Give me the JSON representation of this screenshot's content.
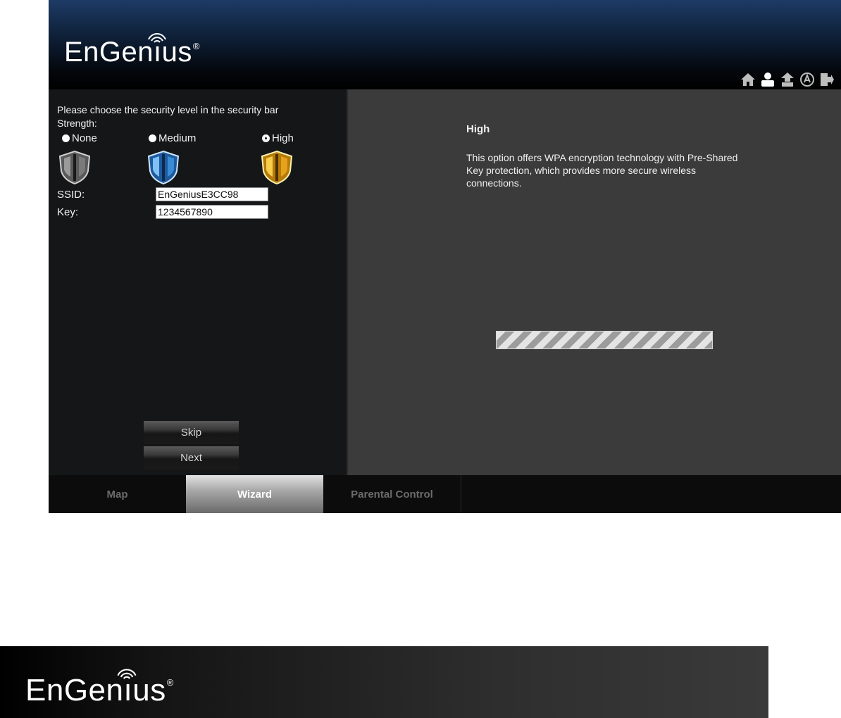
{
  "brand": {
    "name_left": "EnGen",
    "name_i": "ı",
    "name_right": "us",
    "reg_mark": "®"
  },
  "toolbar": {
    "icons": [
      "home-icon",
      "user-icon",
      "upload-icon",
      "wireless-icon",
      "logout-icon"
    ]
  },
  "left_panel": {
    "instruction": "Please choose the security level in the security bar",
    "strength_label": "Strength:",
    "levels": [
      {
        "label": "None",
        "selected": false,
        "color": "#9a9a9a"
      },
      {
        "label": "Medium",
        "selected": false,
        "color": "#3a8bd6"
      },
      {
        "label": "High",
        "selected": true,
        "color": "#e6a21a"
      }
    ],
    "ssid_label": "SSID:",
    "ssid_value": "EnGeniusE3CC98",
    "key_label": "Key:",
    "key_value": "1234567890",
    "skip_label": "Skip",
    "next_label": "Next"
  },
  "right_panel": {
    "title": "High",
    "description": "This option offers WPA encryption technology with Pre-Shared Key protection, which provides more secure wireless connections."
  },
  "tabs": [
    {
      "label": "Map",
      "active": false
    },
    {
      "label": "Wizard",
      "active": true
    },
    {
      "label": "Parental Control",
      "active": false
    }
  ]
}
